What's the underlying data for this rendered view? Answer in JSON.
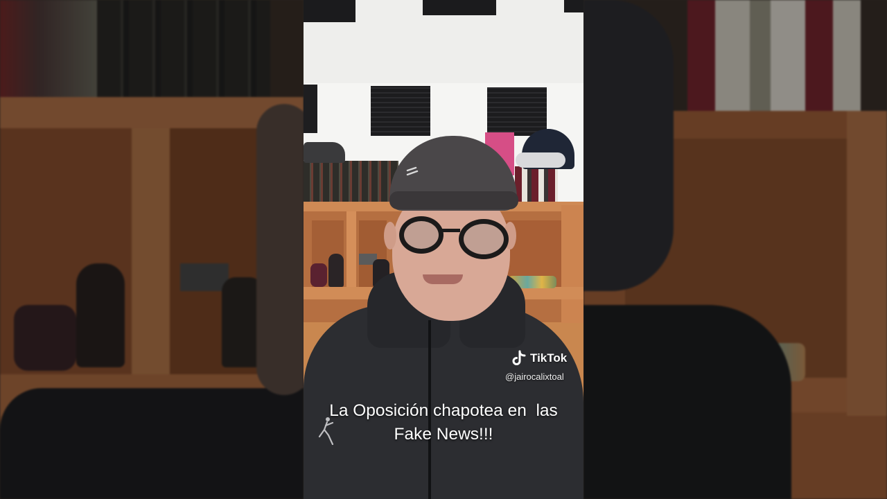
{
  "caption": {
    "line1": "La Oposición chapotea en  las",
    "line2": "Fake News!!!"
  },
  "watermark": {
    "brand": "TikTok",
    "handle": "@jairocalixtoal",
    "icon": "tiktok-logo-icon"
  },
  "colors": {
    "shelf_wood": "#c9874f",
    "wall": "#f2f2f0",
    "jacket": "#2c2d31",
    "caption_text": "#ffffff"
  }
}
